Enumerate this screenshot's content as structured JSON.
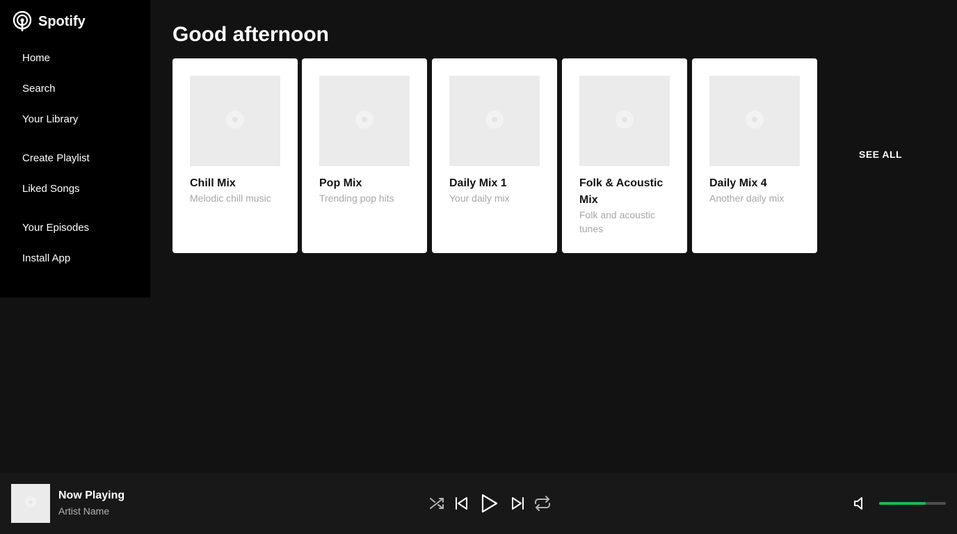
{
  "app": {
    "name": "Spotify"
  },
  "sidebar": {
    "items": [
      {
        "label": "Home"
      },
      {
        "label": "Search"
      },
      {
        "label": "Your Library"
      },
      {
        "label": "Create Playlist"
      },
      {
        "label": "Liked Songs"
      },
      {
        "label": "Your Episodes"
      },
      {
        "label": "Install App"
      }
    ]
  },
  "main": {
    "greeting": "Good afternoon",
    "see_all": "SEE ALL",
    "cards": [
      {
        "title": "Chill Mix",
        "subtitle": "Melodic chill music"
      },
      {
        "title": "Pop Mix",
        "subtitle": "Trending pop hits"
      },
      {
        "title": "Daily Mix 1",
        "subtitle": "Your daily mix"
      },
      {
        "title": "Folk & Acoustic Mix",
        "subtitle": "Folk and acoustic tunes"
      },
      {
        "title": "Daily Mix 4",
        "subtitle": "Another daily mix"
      }
    ]
  },
  "player": {
    "now_playing": "Now Playing",
    "artist": "Artist Name",
    "volume": 0.7,
    "icons": [
      "shuffle-icon",
      "previous-icon",
      "play-icon",
      "next-icon",
      "repeat-icon",
      "volume-icon"
    ]
  },
  "colors": {
    "accent": "#1db954",
    "sidebar_bg": "#000000",
    "main_bg": "#121212",
    "player_bg": "#181818",
    "card_bg": "#ffffff"
  }
}
